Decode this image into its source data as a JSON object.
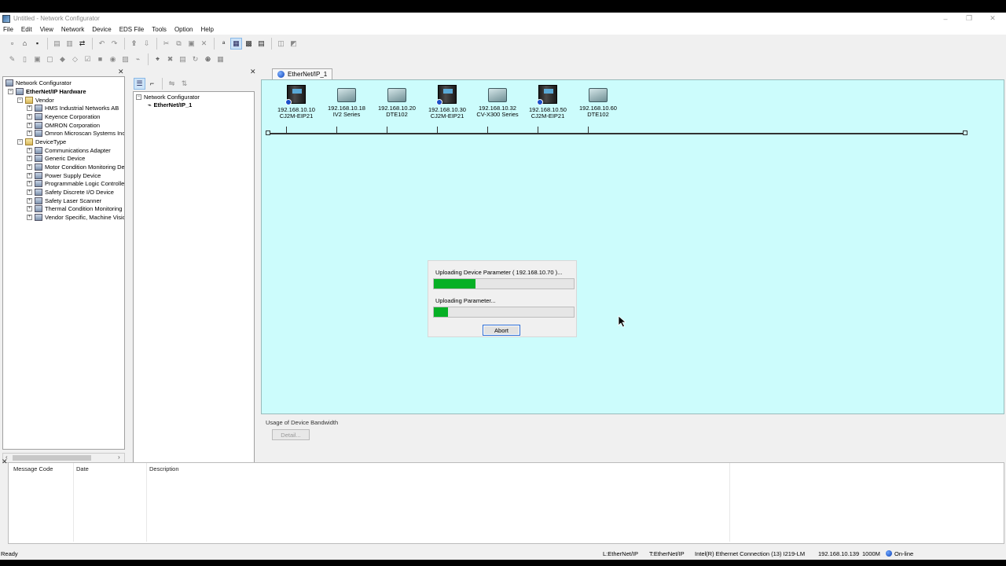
{
  "window": {
    "title": "Untitled - Network Configurator",
    "controls": [
      "–",
      "❐",
      "✕"
    ]
  },
  "menu": [
    "File",
    "Edit",
    "View",
    "Network",
    "Device",
    "EDS File",
    "Tools",
    "Option",
    "Help"
  ],
  "hardware_tree": {
    "root": "Network Configurator",
    "hardware": "EtherNet/IP Hardware",
    "vendor_label": "Vendor",
    "vendors": [
      "HMS Industrial Networks AB",
      "Keyence Corporation",
      "OMRON Corporation",
      "Omron Microscan Systems Inc."
    ],
    "devicetype_label": "DeviceType",
    "device_types": [
      "Communications Adapter",
      "Generic Device",
      "Motor Condition Monitoring Dev",
      "Power Supply Device",
      "Programmable Logic Controller",
      "Safety Discrete I/O Device",
      "Safety Laser Scanner",
      "Thermal Condition Monitoring D",
      "Vendor Specific, Machine Visio"
    ]
  },
  "network_tree": {
    "root": "Network Configurator",
    "child": "EtherNet/IP_1"
  },
  "canvas": {
    "tab_label": "EtherNet/IP_1",
    "nodes": [
      {
        "ip": "192.168.10.10",
        "model": "CJ2M-EIP21",
        "kind": "plc"
      },
      {
        "ip": "192.168.10.18",
        "model": "IV2 Series",
        "kind": "sensor"
      },
      {
        "ip": "192.168.10.20",
        "model": "DTE102",
        "kind": "sensor"
      },
      {
        "ip": "192.168.10.30",
        "model": "CJ2M-EIP21",
        "kind": "plc"
      },
      {
        "ip": "192.168.10.32",
        "model": "CV-X300 Series",
        "kind": "sensor"
      },
      {
        "ip": "192.168.10.50",
        "model": "CJ2M-EIP21",
        "kind": "plc"
      },
      {
        "ip": "192.168.10.60",
        "model": "DTE102",
        "kind": "sensor"
      }
    ]
  },
  "dialog": {
    "line1": "Uploading Device Parameter ( 192.168.10.70 )...",
    "progress1": 0.3,
    "line2": "Uploading Parameter...",
    "progress2": 0.1,
    "abort_label": "Abort"
  },
  "bandwidth": {
    "label": "Usage of Device Bandwidth",
    "detail_label": "Detail..."
  },
  "output": {
    "columns": [
      "Message Code",
      "Date",
      "Description"
    ]
  },
  "status": {
    "ready": "Ready",
    "local": "L:EtherNet/IP",
    "target": "T:EtherNet/IP",
    "adapter": "Intel(R) Ethernet Connection (13) I219-LM",
    "ip": "192.168.10.139",
    "speed": "1000M",
    "state": "On-line"
  },
  "colors": {
    "canvas_bg": "#ccfcfc",
    "progress": "#06b025",
    "online": "#0b3fb5"
  }
}
